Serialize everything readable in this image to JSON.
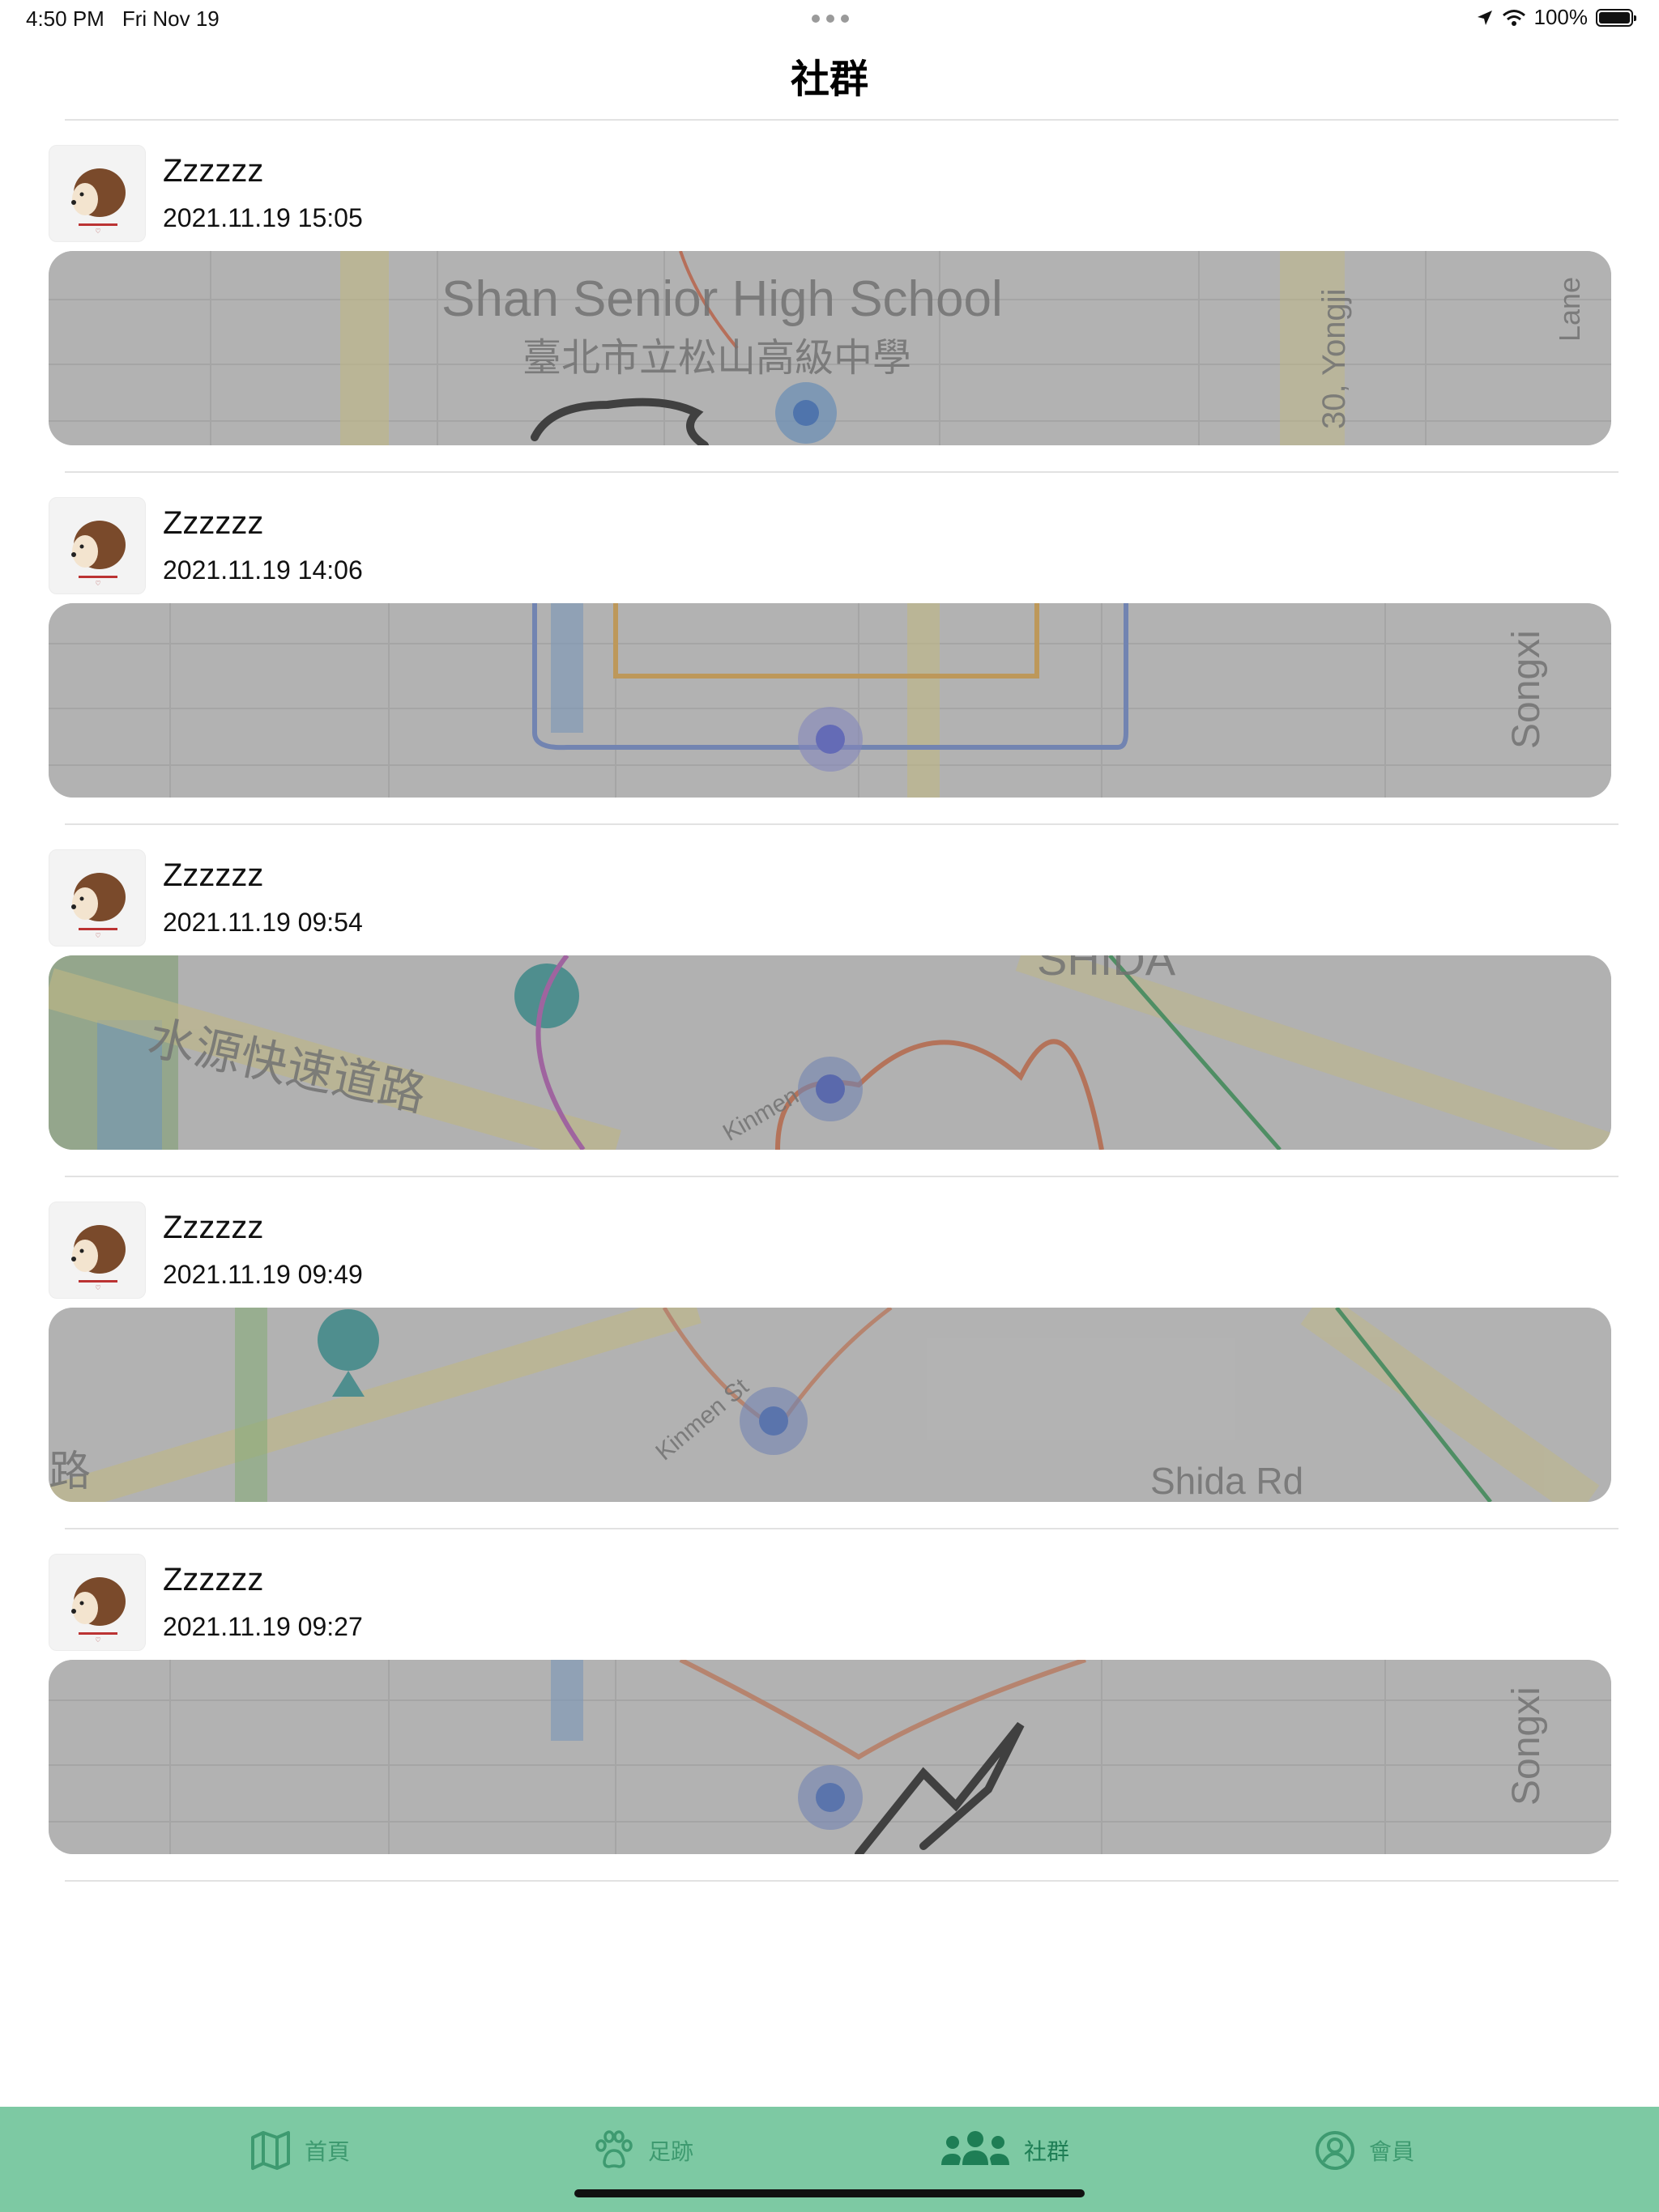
{
  "status_bar": {
    "time": "4:50 PM",
    "date": "Fri Nov 19",
    "battery": "100%",
    "icons": [
      "location-arrow-icon",
      "wifi-icon",
      "battery-icon"
    ]
  },
  "nav": {
    "title": "社群"
  },
  "posts": [
    {
      "user": "Zzzzzz",
      "time": "2021.11.19 15:05",
      "map_labels": [
        "Shan Senior High School",
        "臺北市立松山高級中學",
        "30, Yongji",
        "Lane"
      ]
    },
    {
      "user": "Zzzzzz",
      "time": "2021.11.19 14:06",
      "map_labels": [
        "Songxi"
      ]
    },
    {
      "user": "Zzzzzz",
      "time": "2021.11.19 09:54",
      "map_labels": [
        "水源快速道路",
        "SHIDA",
        "Kinmen"
      ]
    },
    {
      "user": "Zzzzzz",
      "time": "2021.11.19 09:49",
      "map_labels": [
        "路",
        "Kinmen St",
        "Shida Rd"
      ]
    },
    {
      "user": "Zzzzzz",
      "time": "2021.11.19 09:27",
      "map_labels": [
        "Songxi"
      ]
    }
  ],
  "tabs": [
    {
      "label": "首頁",
      "icon": "map-icon"
    },
    {
      "label": "足跡",
      "icon": "paw-icon"
    },
    {
      "label": "社群",
      "icon": "people-icon",
      "active": true
    },
    {
      "label": "會員",
      "icon": "person-circle-icon"
    }
  ],
  "colors": {
    "tab_bar": "#7dc9a3",
    "tab_label": "#3e9a70",
    "tab_active": "#1e7e55",
    "divider": "#e2e2e2"
  }
}
